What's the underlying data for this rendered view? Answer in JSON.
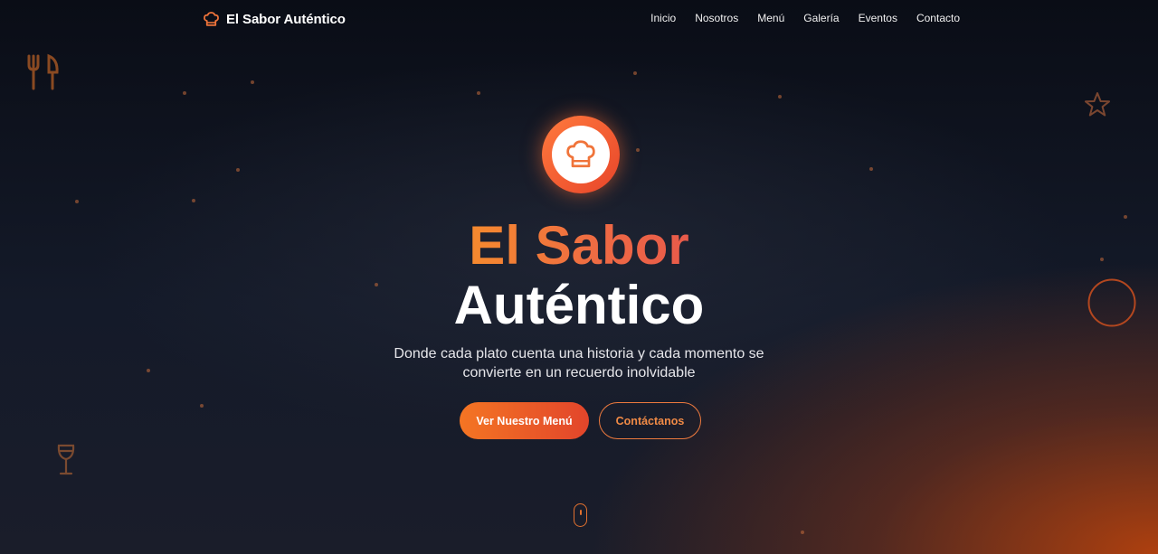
{
  "brand": {
    "name": "El Sabor Auténtico",
    "icon": "chef-hat-icon"
  },
  "nav": {
    "links": [
      "Inicio",
      "Nosotros",
      "Menú",
      "Galería",
      "Eventos",
      "Contacto"
    ]
  },
  "hero": {
    "icon": "chef-hat-icon",
    "title_line1": "El Sabor",
    "title_line2": "Auténtico",
    "subtitle": "Donde cada plato cuenta una historia y cada momento se convierte en un recuerdo inolvidable",
    "primary_button": "Ver Nuestro Menú",
    "secondary_button": "Contáctanos"
  },
  "colors": {
    "accent": "#f0743a",
    "accent_dark": "#e2452b",
    "background": "#0b0f1a"
  }
}
